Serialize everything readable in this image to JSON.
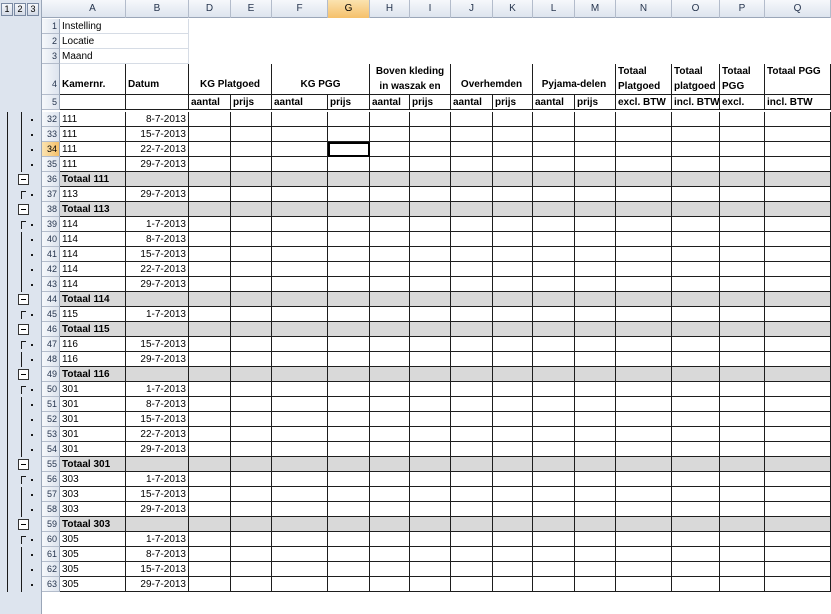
{
  "outline": {
    "levels": [
      "1",
      "2",
      "3"
    ]
  },
  "columns": [
    "A",
    "B",
    "D",
    "E",
    "F",
    "G",
    "H",
    "I",
    "J",
    "K",
    "L",
    "M",
    "N",
    "O",
    "P",
    "Q"
  ],
  "active_column": "G",
  "active_row": "34",
  "top_rows": [
    {
      "num": "1",
      "label": "Instelling"
    },
    {
      "num": "2",
      "label": "Locatie"
    },
    {
      "num": "3",
      "label": "Maand"
    }
  ],
  "header_row4": {
    "num": "4",
    "A": "Kamernr.",
    "B": "Datum",
    "DE": "KG Platgoed",
    "FG": "KG PGG",
    "HI": "Boven kleding in waszak en",
    "JK": "Overhemden",
    "LM": "Pyjama-delen",
    "N": "Totaal Platgoed",
    "O": "Totaal platgoed",
    "P": "Totaal PGG",
    "Q": "Totaal PGG"
  },
  "header_row5": {
    "num": "5",
    "D": "aantal",
    "E": "prijs",
    "F": "aantal",
    "G": "prijs",
    "H": "aantal",
    "I": "prijs",
    "J": "aantal",
    "K": "prijs",
    "L": "aantal",
    "M": "prijs",
    "N": "excl. BTW",
    "O": "incl. BTW",
    "P": "excl.",
    "Q": "incl. BTW"
  },
  "data_rows": [
    {
      "num": "32",
      "kamer": "111",
      "datum": "8-7-2013",
      "total": false
    },
    {
      "num": "33",
      "kamer": "111",
      "datum": "15-7-2013",
      "total": false
    },
    {
      "num": "34",
      "kamer": "111",
      "datum": "22-7-2013",
      "total": false
    },
    {
      "num": "35",
      "kamer": "111",
      "datum": "29-7-2013",
      "total": false
    },
    {
      "num": "36",
      "kamer": "Totaal 111",
      "datum": "",
      "total": true
    },
    {
      "num": "37",
      "kamer": "113",
      "datum": "29-7-2013",
      "total": false
    },
    {
      "num": "38",
      "kamer": "Totaal 113",
      "datum": "",
      "total": true
    },
    {
      "num": "39",
      "kamer": "114",
      "datum": "1-7-2013",
      "total": false
    },
    {
      "num": "40",
      "kamer": "114",
      "datum": "8-7-2013",
      "total": false
    },
    {
      "num": "41",
      "kamer": "114",
      "datum": "15-7-2013",
      "total": false
    },
    {
      "num": "42",
      "kamer": "114",
      "datum": "22-7-2013",
      "total": false
    },
    {
      "num": "43",
      "kamer": "114",
      "datum": "29-7-2013",
      "total": false
    },
    {
      "num": "44",
      "kamer": "Totaal 114",
      "datum": "",
      "total": true
    },
    {
      "num": "45",
      "kamer": "115",
      "datum": "1-7-2013",
      "total": false
    },
    {
      "num": "46",
      "kamer": "Totaal 115",
      "datum": "",
      "total": true
    },
    {
      "num": "47",
      "kamer": "116",
      "datum": "15-7-2013",
      "total": false
    },
    {
      "num": "48",
      "kamer": "116",
      "datum": "29-7-2013",
      "total": false
    },
    {
      "num": "49",
      "kamer": "Totaal 116",
      "datum": "",
      "total": true
    },
    {
      "num": "50",
      "kamer": "301",
      "datum": "1-7-2013",
      "total": false
    },
    {
      "num": "51",
      "kamer": "301",
      "datum": "8-7-2013",
      "total": false
    },
    {
      "num": "52",
      "kamer": "301",
      "datum": "15-7-2013",
      "total": false
    },
    {
      "num": "53",
      "kamer": "301",
      "datum": "22-7-2013",
      "total": false
    },
    {
      "num": "54",
      "kamer": "301",
      "datum": "29-7-2013",
      "total": false
    },
    {
      "num": "55",
      "kamer": "Totaal 301",
      "datum": "",
      "total": true
    },
    {
      "num": "56",
      "kamer": "303",
      "datum": "1-7-2013",
      "total": false
    },
    {
      "num": "57",
      "kamer": "303",
      "datum": "15-7-2013",
      "total": false
    },
    {
      "num": "58",
      "kamer": "303",
      "datum": "29-7-2013",
      "total": false
    },
    {
      "num": "59",
      "kamer": "Totaal 303",
      "datum": "",
      "total": true
    },
    {
      "num": "60",
      "kamer": "305",
      "datum": "1-7-2013",
      "total": false
    },
    {
      "num": "61",
      "kamer": "305",
      "datum": "8-7-2013",
      "total": false
    },
    {
      "num": "62",
      "kamer": "305",
      "datum": "15-7-2013",
      "total": false
    },
    {
      "num": "63",
      "kamer": "305",
      "datum": "29-7-2013",
      "total": false
    }
  ],
  "colors": {
    "total_row_fill": "#d9d9d9",
    "header_fill": "#dde4ee",
    "active_header": "#f5c06a"
  }
}
